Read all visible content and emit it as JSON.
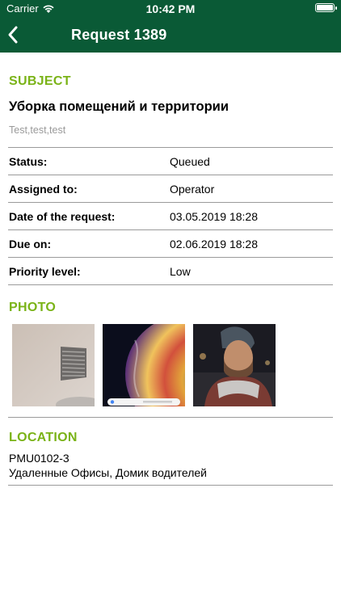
{
  "status_bar": {
    "carrier": "Carrier",
    "time": "10:42 PM"
  },
  "nav": {
    "title": "Request 1389",
    "back_icon": "chevron-left-icon"
  },
  "subject": {
    "header": "SUBJECT",
    "title": "Уборка помещений и территории",
    "description": "Test,test,test"
  },
  "details": [
    {
      "label": "Status:",
      "value": "Queued"
    },
    {
      "label": "Assigned to:",
      "value": "Operator"
    },
    {
      "label": "Date of the request:",
      "value": "03.05.2019 18:28"
    },
    {
      "label": "Due on:",
      "value": "02.06.2019 18:28"
    },
    {
      "label": "Priority level:",
      "value": "Low"
    }
  ],
  "photo": {
    "header": "PHOTO",
    "count": 3
  },
  "location": {
    "header": "LOCATION",
    "code": "PMU0102-3",
    "name": "Удаленные Офисы, Домик водителей"
  },
  "colors": {
    "bar": "#0a5a36",
    "accent": "#7ab317",
    "divider": "#9b9b9b"
  }
}
